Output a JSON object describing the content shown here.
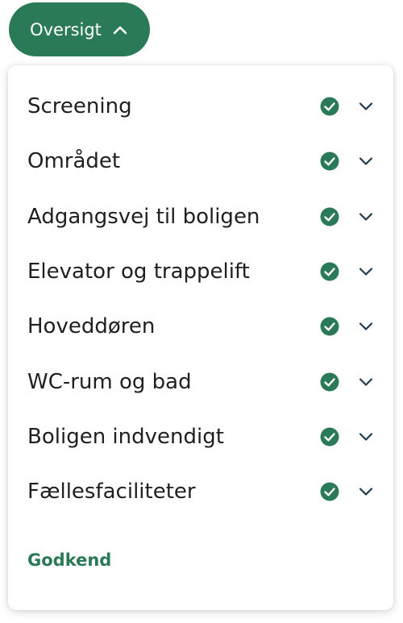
{
  "colors": {
    "accent": "#2a7a57",
    "text": "#1f1f1f",
    "check_fill": "#2a7a57",
    "chevron": "#1f3b4d"
  },
  "toggle": {
    "label": "Oversigt",
    "icon": "chevron-up-icon"
  },
  "sections": [
    {
      "label": "Screening",
      "status_icon": "check-circle-icon",
      "expand_icon": "chevron-down-icon"
    },
    {
      "label": "Området",
      "status_icon": "check-circle-icon",
      "expand_icon": "chevron-down-icon"
    },
    {
      "label": "Adgangsvej til boligen",
      "status_icon": "check-circle-icon",
      "expand_icon": "chevron-down-icon"
    },
    {
      "label": "Elevator og trappelift",
      "status_icon": "check-circle-icon",
      "expand_icon": "chevron-down-icon"
    },
    {
      "label": "Hoveddøren",
      "status_icon": "check-circle-icon",
      "expand_icon": "chevron-down-icon"
    },
    {
      "label": "WC-rum og bad",
      "status_icon": "check-circle-icon",
      "expand_icon": "chevron-down-icon"
    },
    {
      "label": "Boligen indvendigt",
      "status_icon": "check-circle-icon",
      "expand_icon": "chevron-down-icon"
    },
    {
      "label": "Fællesfaciliteter",
      "status_icon": "check-circle-icon",
      "expand_icon": "chevron-down-icon"
    }
  ],
  "footer": {
    "approve_label": "Godkend"
  }
}
